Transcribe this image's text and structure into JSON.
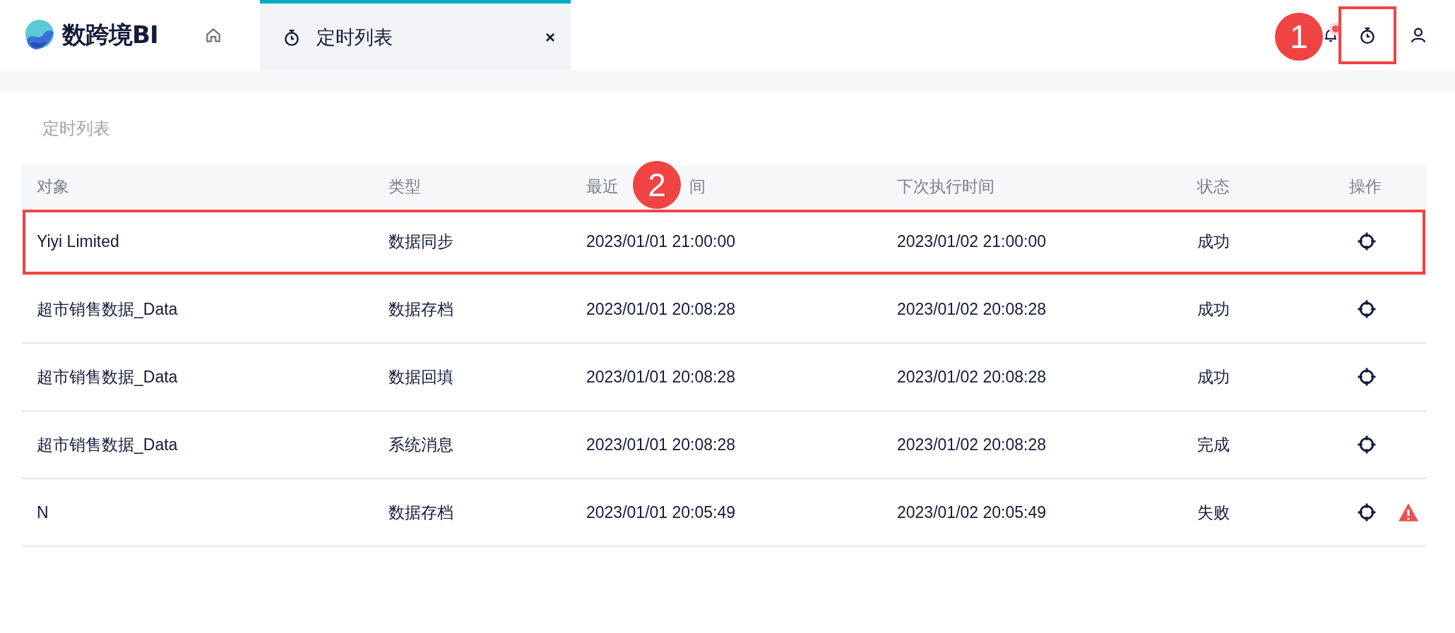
{
  "logo": {
    "text": "数跨境BI"
  },
  "tabs": [
    {
      "kind": "home",
      "selected": false
    },
    {
      "kind": "timer",
      "label": "定时列表",
      "selected": true,
      "closable": true
    }
  ],
  "header_icons": {
    "bell_unread": true,
    "timer_highlighted": true
  },
  "page_title": "定时列表",
  "table": {
    "columns": [
      {
        "parts": [
          "对象"
        ]
      },
      {
        "parts": [
          "类型"
        ]
      },
      {
        "parts": [
          "最近",
          "间"
        ]
      },
      {
        "parts": [
          "下次执行时间"
        ]
      },
      {
        "parts": [
          "状态"
        ]
      },
      {
        "parts": [
          "操作"
        ]
      }
    ],
    "rows": [
      {
        "object": "Yiyi Limited",
        "type": "数据同步",
        "last_run": "2023/01/01 21:00:00",
        "next_run": "2023/01/02 21:00:00",
        "status": "成功",
        "warning": false,
        "highlighted": true
      },
      {
        "object": "超市销售数据_Data",
        "type": "数据存档",
        "last_run": "2023/01/01 20:08:28",
        "next_run": "2023/01/02 20:08:28",
        "status": "成功",
        "warning": false,
        "highlighted": false
      },
      {
        "object": "超市销售数据_Data",
        "type": "数据回填",
        "last_run": "2023/01/01 20:08:28",
        "next_run": "2023/01/02 20:08:28",
        "status": "成功",
        "warning": false,
        "highlighted": false
      },
      {
        "object": "超市销售数据_Data",
        "type": "系统消息",
        "last_run": "2023/01/01 20:08:28",
        "next_run": "2023/01/02 20:08:28",
        "status": "完成",
        "warning": false,
        "highlighted": false
      },
      {
        "object": "N",
        "type": "数据存档",
        "last_run": "2023/01/01 20:05:49",
        "next_run": "2023/01/02 20:05:49",
        "status": "失败",
        "warning": true,
        "highlighted": false
      }
    ]
  },
  "callouts": [
    {
      "label": "1"
    },
    {
      "label": "2"
    }
  ]
}
